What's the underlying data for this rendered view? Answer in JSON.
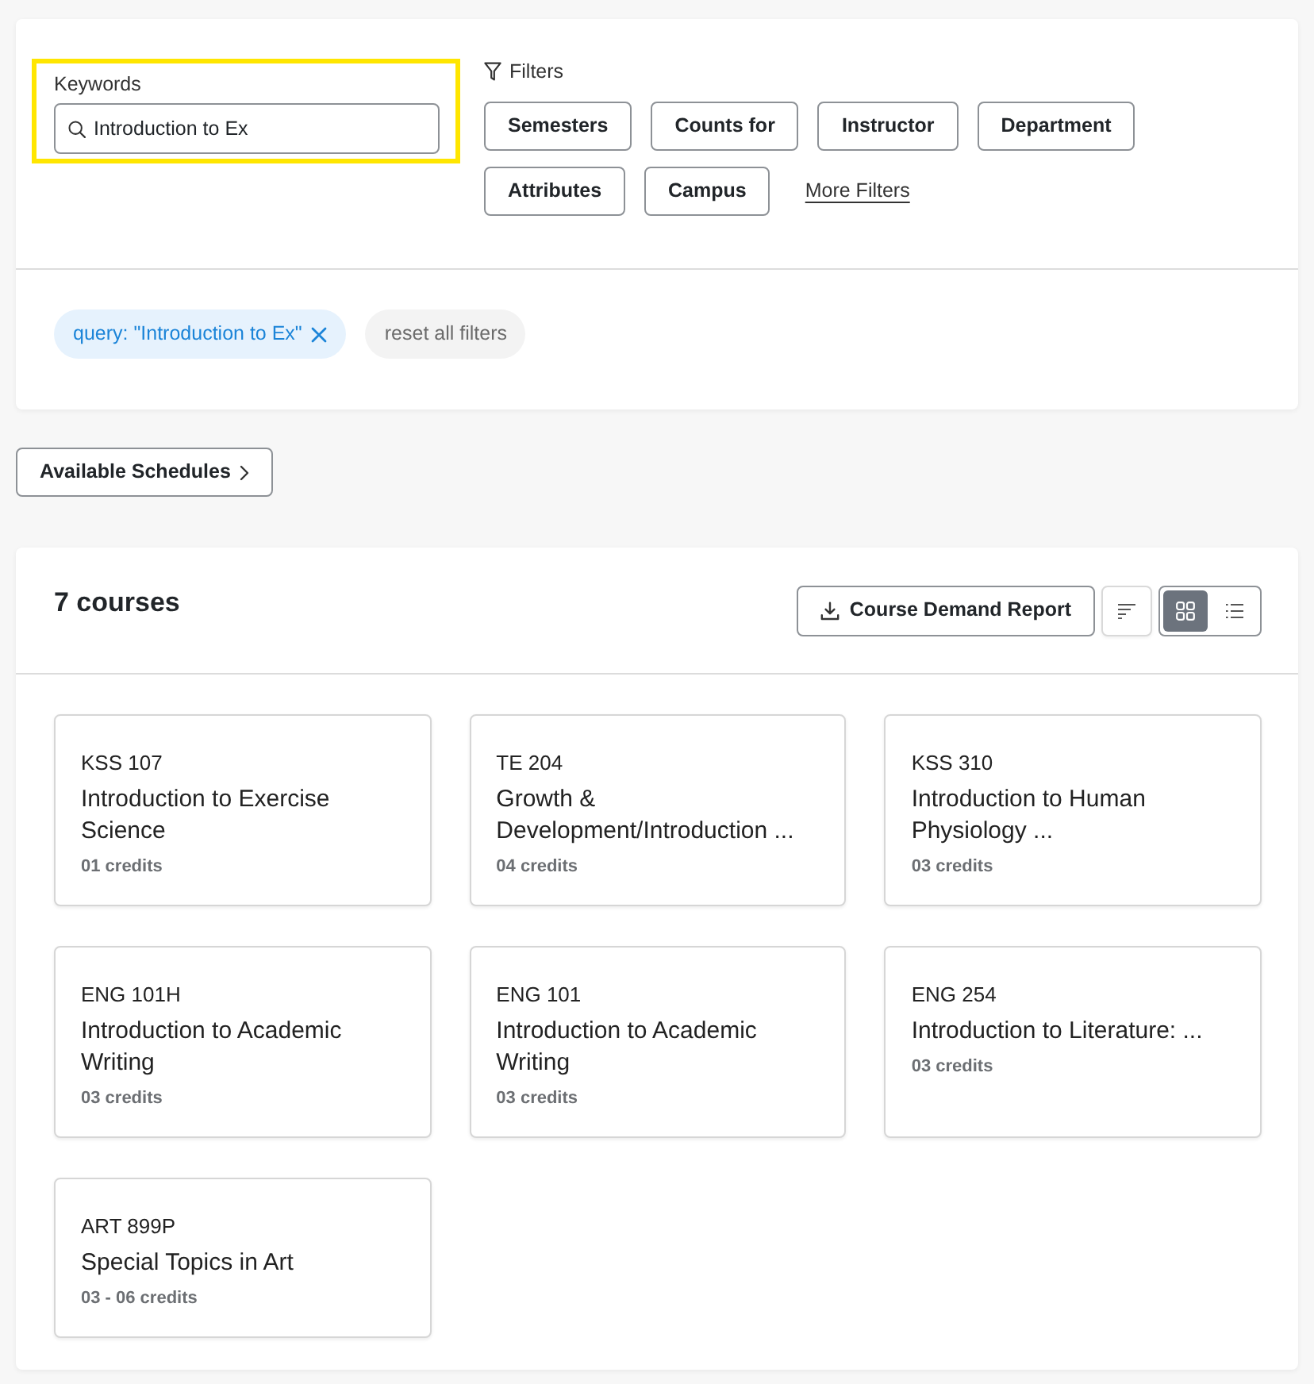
{
  "search": {
    "label": "Keywords",
    "value": "Introduction to Ex",
    "highlighted": true
  },
  "filters": {
    "label": "Filters",
    "buttons": [
      "Semesters",
      "Counts for",
      "Instructor",
      "Department",
      "Attributes",
      "Campus"
    ],
    "more_link": "More Filters"
  },
  "active_filters": [
    {
      "kind": "query",
      "text": "query: \"Introduction to Ex\""
    },
    {
      "kind": "reset",
      "text": "reset all filters"
    }
  ],
  "schedules_button": "Available Schedules",
  "results": {
    "count": "7 courses",
    "report_button": "Course Demand Report",
    "view_modes": [
      {
        "kind": "grid",
        "selected": true
      },
      {
        "kind": "list",
        "selected": false
      }
    ],
    "courses": [
      {
        "code": "KSS 107",
        "title": "Introduction to Exercise Science",
        "credits": "01 credits"
      },
      {
        "code": "TE 204",
        "title": "Growth & Development/Introduction ...",
        "credits": "04 credits"
      },
      {
        "code": "KSS 310",
        "title": "Introduction to Human Physiology ...",
        "credits": "03 credits"
      },
      {
        "code": "ENG 101H",
        "title": "Introduction to Academic Writing",
        "credits": "03 credits"
      },
      {
        "code": "ENG 101",
        "title": "Introduction to Academic Writing",
        "credits": "03 credits"
      },
      {
        "code": "ENG 254",
        "title": "Introduction to Literature: ...",
        "credits": "03 credits"
      },
      {
        "code": "ART 899P",
        "title": "Special Topics in Art",
        "credits": "03 - 06 credits"
      }
    ]
  }
}
